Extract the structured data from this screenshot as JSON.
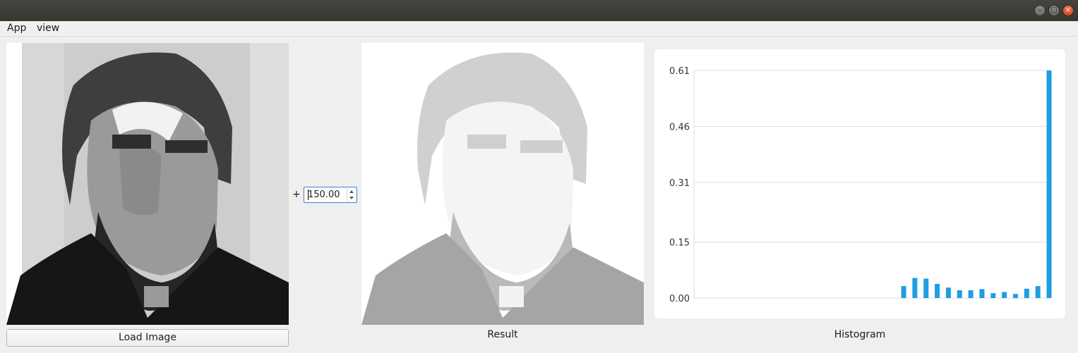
{
  "window": {
    "controls": [
      "minimize-icon",
      "maximize-icon",
      "close-icon"
    ]
  },
  "menubar": {
    "items": [
      "App",
      "view"
    ]
  },
  "left": {
    "button_label": "Load Image"
  },
  "operation": {
    "symbol": "+",
    "value": "150.00"
  },
  "result": {
    "caption": "Result"
  },
  "histogram": {
    "caption": "Histogram"
  },
  "colors": {
    "bar": "#1f9ee1",
    "grid": "#dcdcdc",
    "accent": "#3a85d0"
  },
  "chart_data": {
    "type": "bar",
    "y_ticks": [
      "0.61",
      "0.46",
      "0.31",
      "0.15",
      "0.00"
    ],
    "ylim": [
      0,
      0.61
    ],
    "xlim": [
      0,
      255
    ],
    "grid": true,
    "values": [
      0.032,
      0.054,
      0.052,
      0.038,
      0.028,
      0.021,
      0.021,
      0.024,
      0.013,
      0.016,
      0.011,
      0.025,
      0.032,
      0.61
    ],
    "x": [
      150,
      158,
      166,
      174,
      182,
      190,
      198,
      206,
      214,
      222,
      230,
      238,
      246,
      254
    ]
  }
}
